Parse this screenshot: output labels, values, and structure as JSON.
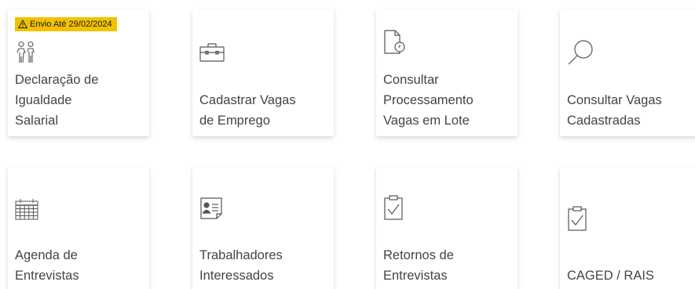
{
  "cards": [
    {
      "label": "Declaração de\nIgualdade\nSalarial",
      "icon": "people-equality-icon",
      "badge": "Envio Até 29/02/2024"
    },
    {
      "label": "Cadastrar Vagas\nde Emprego",
      "icon": "briefcase-icon"
    },
    {
      "label": "Consultar\nProcessamento\nVagas em Lote",
      "icon": "document-clock-icon"
    },
    {
      "label": "Consultar Vagas\nCadastradas",
      "icon": "search-icon"
    },
    {
      "label": "Agenda de\nEntrevistas",
      "icon": "calendar-icon"
    },
    {
      "label": "Trabalhadores\nInteressados",
      "icon": "id-card-icon"
    },
    {
      "label": "Retornos de\nEntrevistas",
      "icon": "clipboard-check-icon"
    },
    {
      "label": "CAGED / RAIS",
      "icon": "clipboard-check-icon"
    }
  ],
  "colors": {
    "badge_bg": "#f2c200",
    "text": "#444444",
    "icon": "#555555"
  }
}
